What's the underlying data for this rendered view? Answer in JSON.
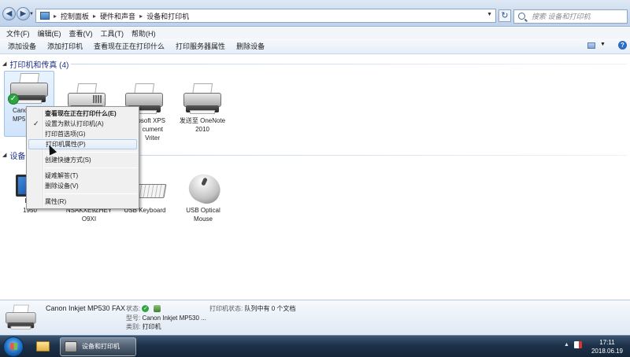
{
  "address": {
    "breadcrumbs": [
      "控制面板",
      "硬件和声音",
      "设备和打印机"
    ],
    "search_placeholder": "搜索 设备和打印机"
  },
  "menu": [
    "文件(F)",
    "编辑(E)",
    "查看(V)",
    "工具(T)",
    "帮助(H)"
  ],
  "commands": [
    "添加设备",
    "添加打印机",
    "查看现在正在打印什么",
    "打印服务器属性",
    "删除设备"
  ],
  "groups": {
    "printers": {
      "title": "打印机和传真 (4)"
    },
    "devices": {
      "title": "设备 ("
    }
  },
  "printers": [
    {
      "line1": "Cano",
      "line2": "MP5",
      "line3": ""
    },
    {
      "line1": "",
      "line2": "",
      "line3": ""
    },
    {
      "line1": "osoft XPS",
      "line2": "cument",
      "line3": "Vriter"
    },
    {
      "line1": "发送至 OneNote",
      "line2": "2010",
      "line3": ""
    }
  ],
  "devices": [
    {
      "line1": "1950",
      "line2": ""
    },
    {
      "line1": "NSAKXE9ZHEY",
      "line2": "O9XI"
    },
    {
      "line1": "USB Keyboard",
      "line2": ""
    },
    {
      "line1": "USB Optical",
      "line2": "Mouse"
    }
  ],
  "context_menu": [
    {
      "label": "查看现在正在打印什么(E)",
      "bold": true
    },
    {
      "label": "设置为默认打印机(A)",
      "checked": true
    },
    {
      "label": "打印首选项(G)"
    },
    {
      "label": "打印机属性(P)",
      "hover": true
    },
    {
      "label": "创建快捷方式(S)"
    },
    {
      "label": "疑难解答(T)"
    },
    {
      "label": "删除设备(V)"
    },
    {
      "label": "属性(R)"
    }
  ],
  "details": {
    "name": "Canon Inkjet MP530 FAX",
    "status_label": "状态:",
    "model_label": "型号:",
    "model_value": "Canon Inkjet MP530 ...",
    "category_label": "类别:",
    "category_value": "打印机",
    "printer_status_label": "打印机状态:",
    "printer_status_value": "队列中有 0 个文档"
  },
  "taskbar": {
    "app_label": "设备和打印机",
    "time": "17:11",
    "date": "2018.06.19"
  },
  "colors": {
    "accent": "#1e3287",
    "default_check": "#2ea443"
  },
  "icons": [
    "back-icon",
    "forward-icon",
    "refresh-icon",
    "search-icon",
    "printer-icon",
    "fax-icon",
    "monitor-icon",
    "keyboard-icon",
    "mouse-icon",
    "default-check-icon",
    "folder-icon",
    "start-orb-icon",
    "flag-icon"
  ]
}
